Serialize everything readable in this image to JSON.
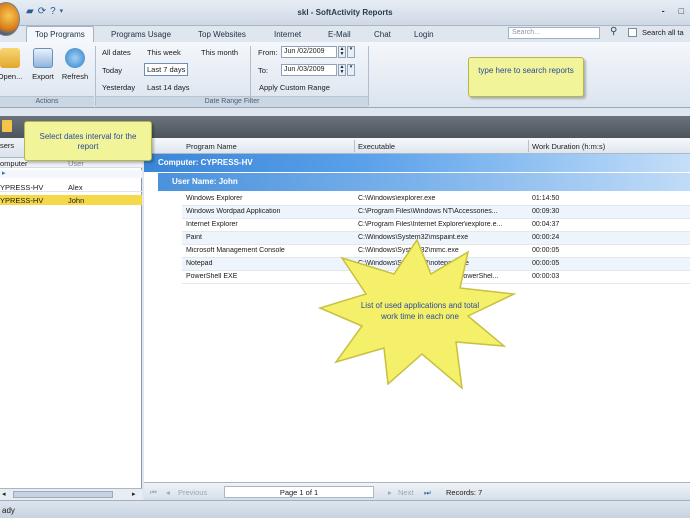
{
  "window": {
    "title": "skl - SoftActivity Reports",
    "minimize": "-",
    "maximize": "□"
  },
  "tabs": [
    "Top Programs",
    "Programs Usage",
    "Top Websites",
    "Internet",
    "E-Mail",
    "Chat",
    "Login"
  ],
  "search": {
    "placeholder": "Search...",
    "all_label": "Search all ta"
  },
  "actions": {
    "open": "Open...",
    "export": "Export",
    "refresh": "Refresh",
    "group_label": "Actions"
  },
  "date_range": {
    "all_dates": "All dates",
    "this_week": "This week",
    "this_month": "This month",
    "today": "Today",
    "last7": "Last 7 days",
    "yesterday": "Yesterday",
    "last14": "Last 14 days",
    "from_label": "From:",
    "from_value": "Jun /02/2009",
    "to_label": "To:",
    "to_value": "Jun /03/2009",
    "apply": "Apply Custom Range",
    "group_label": "Date Range Filter"
  },
  "tooltips": {
    "search": "type here to search reports",
    "dates": "Select dates interval for the report",
    "star": "List of used applications and total work time in each one"
  },
  "left_panel": {
    "header": "sers",
    "col_computer": "omputer",
    "col_user": "User",
    "rows": [
      {
        "computer": "YPRESS-HV",
        "user": "Alex"
      },
      {
        "computer": "YPRESS-HV",
        "user": "John"
      }
    ]
  },
  "grid": {
    "columns": [
      "Program Name",
      "Executable",
      "Work Duration (h:m:s)"
    ],
    "computer_group": "Computer: CYPRESS-HV",
    "user_group": "User Name: John",
    "rows": [
      {
        "program": "Windows Explorer",
        "exe": "C:\\Windows\\explorer.exe",
        "duration": "01:14:50"
      },
      {
        "program": "Windows Wordpad Application",
        "exe": "C:\\Program Files\\Windows NT\\Accessories...",
        "duration": "00:09:30"
      },
      {
        "program": "Internet Explorer",
        "exe": "C:\\Program Files\\Internet Explorer\\iexplore.e...",
        "duration": "00:04:37"
      },
      {
        "program": "Paint",
        "exe": "C:\\Windows\\System32\\mspaint.exe",
        "duration": "00:00:24"
      },
      {
        "program": "Microsoft Management Console",
        "exe": "C:\\Windows\\System32\\mmc.exe",
        "duration": "00:00:05"
      },
      {
        "program": "Notepad",
        "exe": "C:\\Windows\\System32\\notepad.exe",
        "duration": "00:00:05"
      },
      {
        "program": "PowerShell EXE",
        "exe": "C:\\Windows\\System32\\WindowsPowerShel...",
        "duration": "00:00:03"
      }
    ]
  },
  "pager": {
    "previous": "Previous",
    "page": "Page 1 of 1",
    "next": "Next",
    "records": "Records: 7"
  },
  "status": "ady",
  "colors": {
    "accent": "#3a86d6",
    "tooltip": "#f2f49a",
    "star": "#f5f06a",
    "selected_row": "#f5d84a"
  }
}
